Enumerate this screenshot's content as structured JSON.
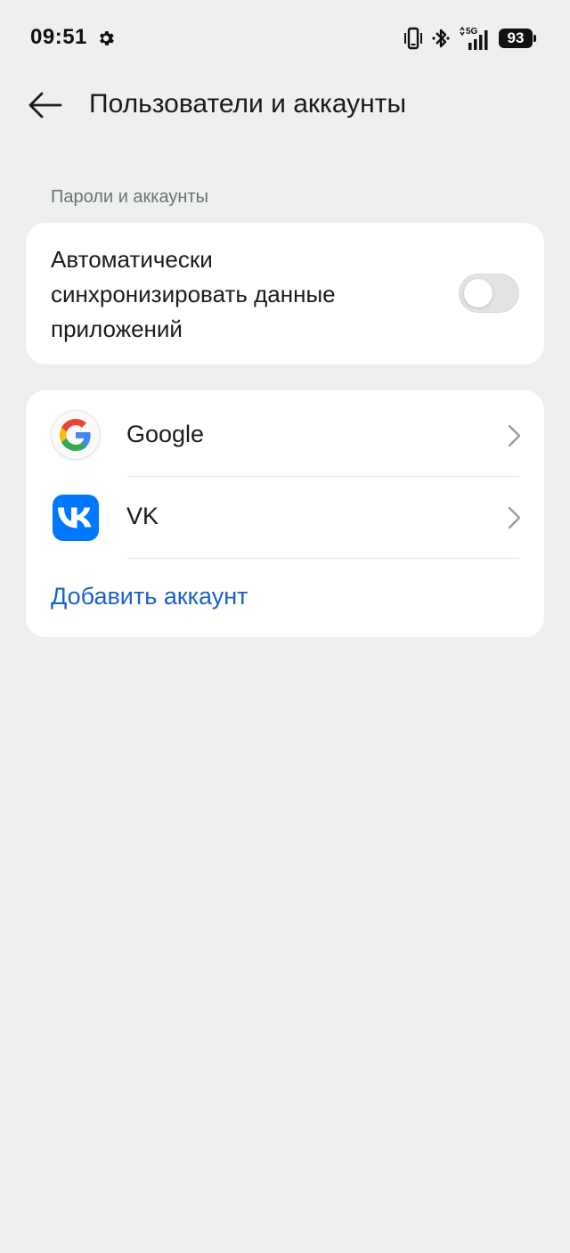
{
  "status_bar": {
    "time": "09:51",
    "network": "5G",
    "battery": "93",
    "icons": [
      "settings-icon",
      "vibrate-icon",
      "bluetooth-icon",
      "signal-icon",
      "battery-icon"
    ]
  },
  "header": {
    "title": "Пользователи и аккаунты",
    "back_icon": "back-arrow-icon"
  },
  "section": {
    "label": "Пароли и аккаунты"
  },
  "sync": {
    "label": "Автоматически синхронизировать данные приложений",
    "enabled": false
  },
  "accounts": [
    {
      "name": "Google",
      "icon": "google-logo-icon"
    },
    {
      "name": "VK",
      "icon": "vk-logo-icon"
    }
  ],
  "add_account_label": "Добавить аккаунт",
  "colors": {
    "background": "#edf0ef",
    "card": "#ffffff",
    "link": "#1a62c8",
    "vk_brand": "#0077ff"
  }
}
